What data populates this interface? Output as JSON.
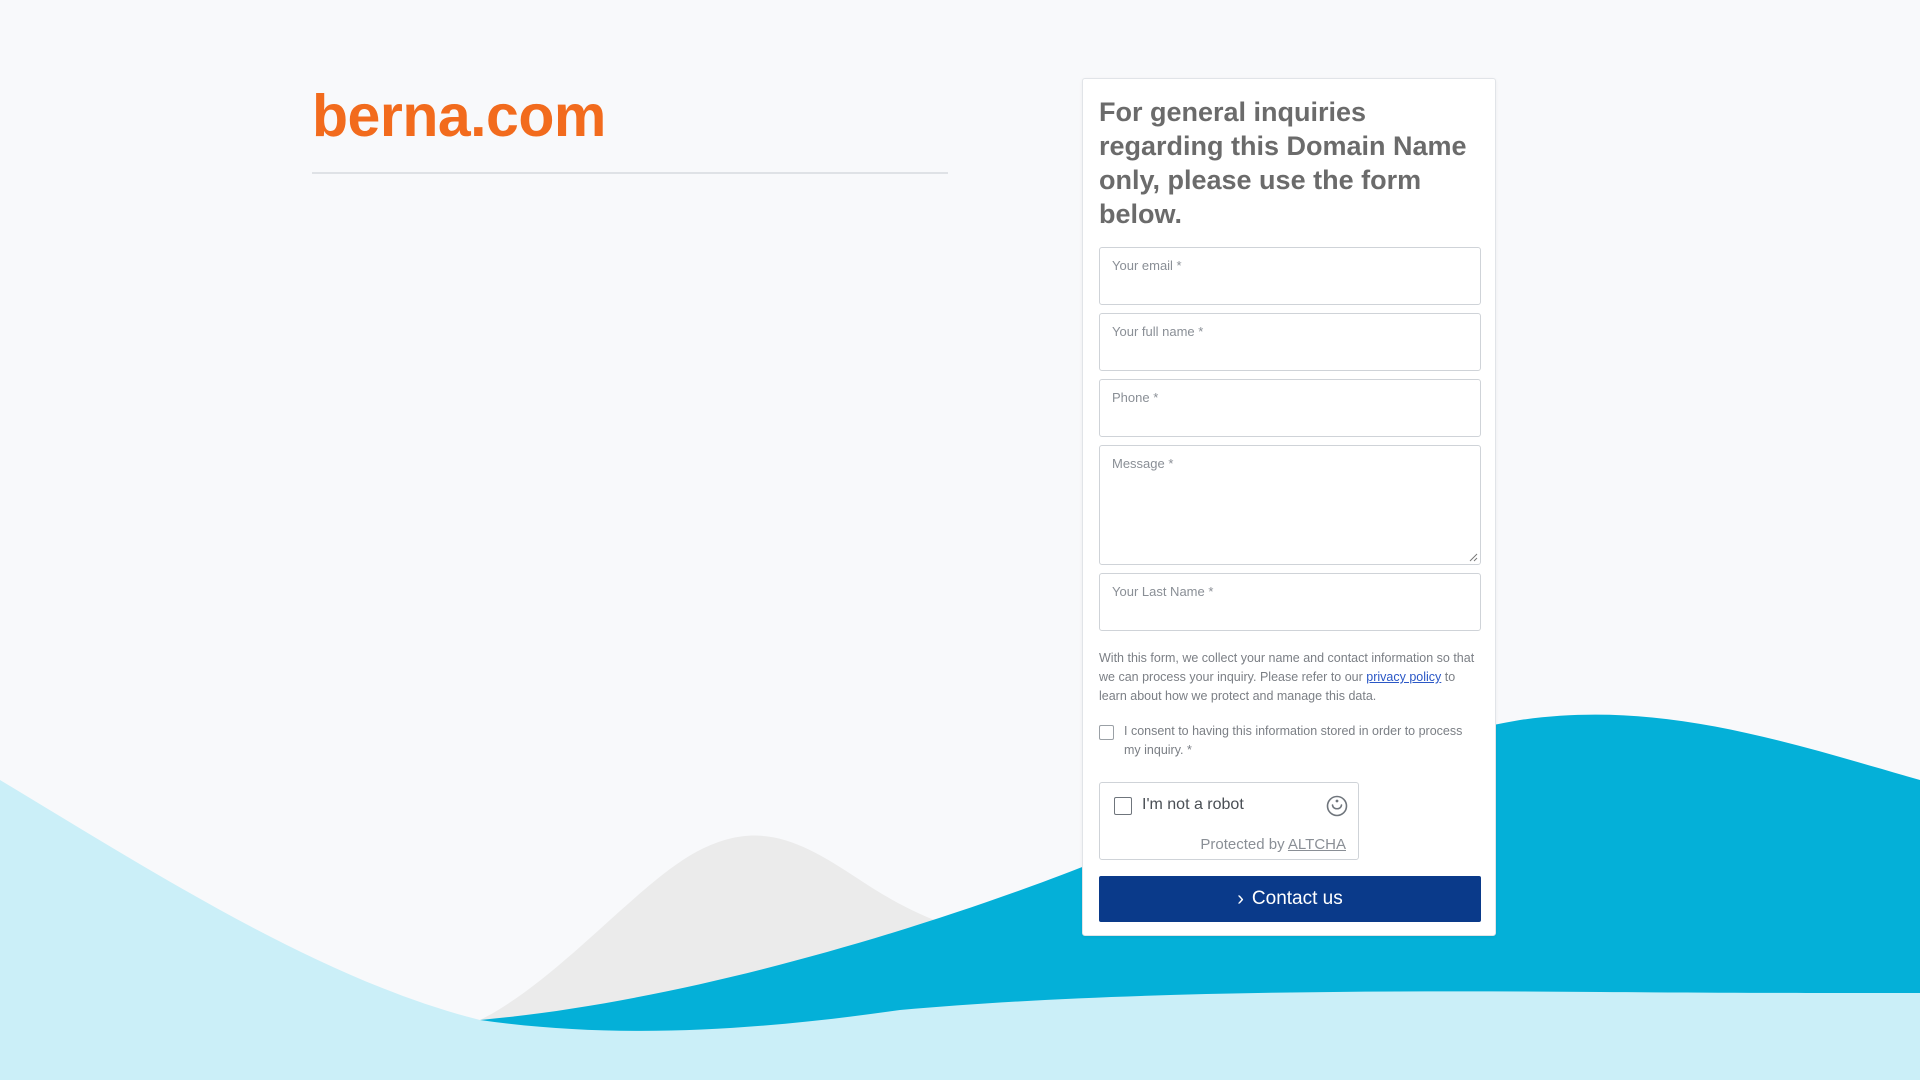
{
  "brand": {
    "title": "berna.com",
    "color": "#f26b1d"
  },
  "form": {
    "heading": "For general inquiries regarding this Domain Name only, please use the form below.",
    "fields": [
      {
        "label": "Your email *",
        "value": ""
      },
      {
        "label": "Your full name *",
        "value": ""
      },
      {
        "label": "Phone *",
        "value": ""
      },
      {
        "label": "Message *",
        "value": ""
      },
      {
        "label": "Your Last Name *",
        "value": ""
      }
    ],
    "privacy": {
      "before": "With this form, we collect your name and contact information so that we can process your inquiry. Please refer to our ",
      "link": "privacy policy",
      "after": " to learn about how we protect and manage this data."
    },
    "consent": {
      "label": "I consent to having this information stored in order to process my inquiry. *",
      "checked": false
    },
    "captcha": {
      "label": "I'm not a robot",
      "protected_by": "Protected by",
      "provider": "ALTCHA",
      "checked": false
    },
    "submit_label": "Contact us"
  },
  "colors": {
    "primary_button": "#0a3a8a",
    "wave_dark": "#04b0d8",
    "wave_light": "#cbeff8",
    "wave_grey": "#ebebeb"
  }
}
